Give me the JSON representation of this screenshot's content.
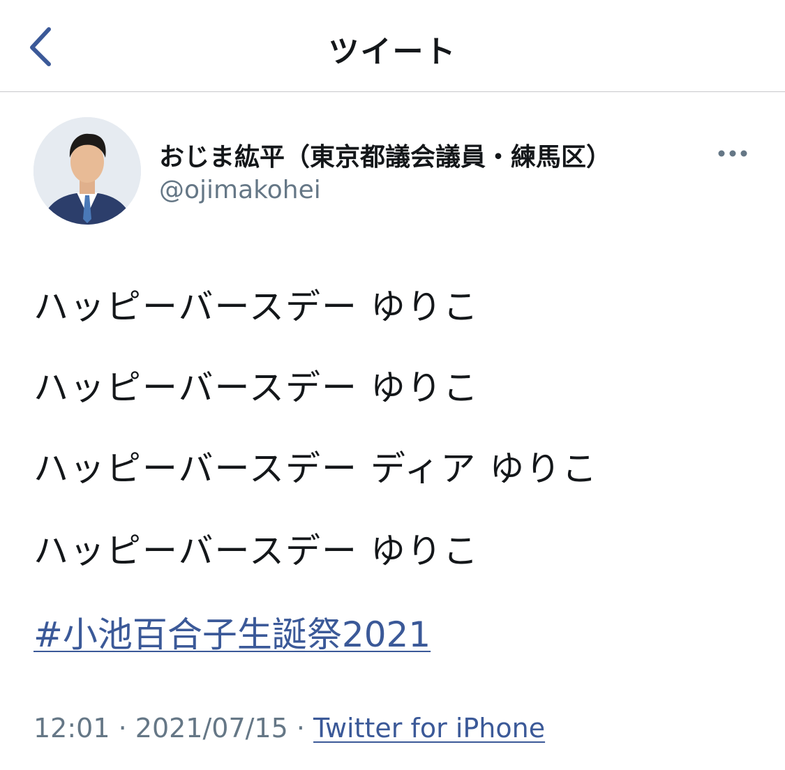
{
  "colors": {
    "link": "#3b5998",
    "text": "#14171a",
    "secondary": "#657786",
    "divider": "#c8c8cc"
  },
  "navbar": {
    "back_icon": "chevron-left-icon",
    "title": "ツイート"
  },
  "author": {
    "display_name": "おじま紘平（東京都議会議員・練馬区）",
    "handle": "@ojimakohei",
    "more_icon": "ellipsis-icon"
  },
  "tweet": {
    "lines": [
      "ハッピーバースデー ゆりこ",
      "ハッピーバースデー ゆりこ",
      "ハッピーバースデー ディア ゆりこ",
      "ハッピーバースデー ゆりこ"
    ],
    "hashtag": "#小池百合子生誕祭2021"
  },
  "meta": {
    "time": "12:01",
    "separator": " · ",
    "date": "2021/07/15",
    "source": "Twitter for iPhone"
  }
}
